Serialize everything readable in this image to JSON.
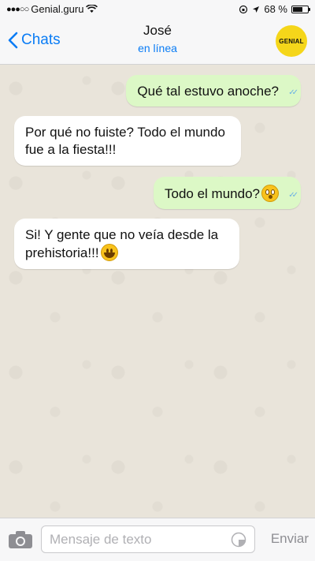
{
  "status_bar": {
    "carrier": "Genial.guru",
    "battery": "68 %",
    "battery_level": 0.68
  },
  "header": {
    "back_label": "Chats",
    "contact_name": "José",
    "contact_status": "en línea",
    "avatar_text": "GENIAL"
  },
  "messages": [
    {
      "direction": "out",
      "text": "Qué tal estuvo anoche?"
    },
    {
      "direction": "in",
      "text": "Por qué no fuiste? Todo el mundo fue a la fiesta!!!"
    },
    {
      "direction": "out",
      "text": "Todo el mundo?",
      "emoji": "flushed-face"
    },
    {
      "direction": "in",
      "text": "Si! Y gente que no veía desde la prehistoria!!!",
      "emoji": "grinning-face"
    }
  ],
  "input": {
    "placeholder": "Mensaje de texto",
    "value": "",
    "send_label": "Enviar"
  },
  "colors": {
    "accent": "#0a7cf5",
    "outgoing_bubble": "#dcf8c6",
    "incoming_bubble": "#ffffff",
    "avatar": "#f5d61a"
  }
}
